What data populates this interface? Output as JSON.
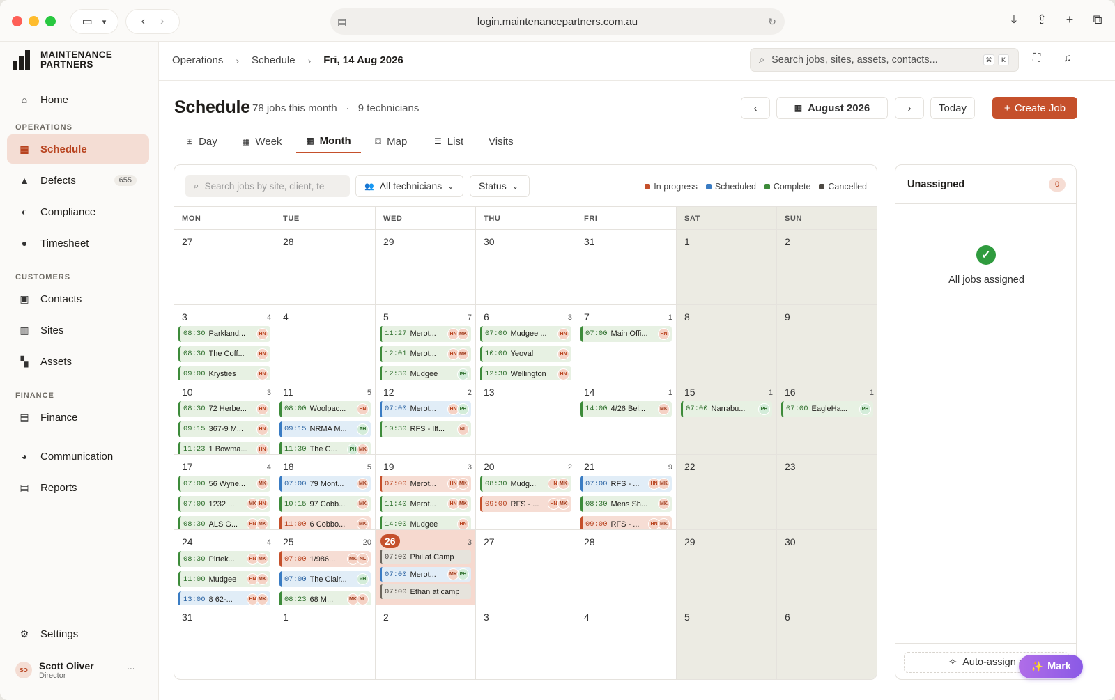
{
  "browser": {
    "url": "login.maintenancepartners.com.au"
  },
  "brand": {
    "line1": "MAINTENANCE",
    "line2": "PARTNERS"
  },
  "sidebar": {
    "home": "Home",
    "sec_operations": "OPERATIONS",
    "schedule": "Schedule",
    "defects": "Defects",
    "defects_count": "655",
    "compliance": "Compliance",
    "timesheet": "Timesheet",
    "sec_customers": "CUSTOMERS",
    "contacts": "Contacts",
    "sites": "Sites",
    "assets": "Assets",
    "sec_finance": "FINANCE",
    "finance": "Finance",
    "communication": "Communication",
    "reports": "Reports",
    "settings": "Settings",
    "user": {
      "initials": "SO",
      "name": "Scott Oliver",
      "role": "Director",
      "more": "..."
    }
  },
  "breadcrumb": {
    "b1": "Operations",
    "b2": "Schedule",
    "b3": "Fri, 14 Aug 2026"
  },
  "global_search": {
    "placeholder": "Search jobs, sites, assets, contacts...",
    "k1": "⌘",
    "k2": "K"
  },
  "page": {
    "title": "Schedule",
    "jobs_meta": "78 jobs this month",
    "dot": "·",
    "tech_meta": "9 technicians",
    "month": "August 2026",
    "today": "Today",
    "create": "Create Job"
  },
  "tabs": {
    "day": "Day",
    "week": "Week",
    "month": "Month",
    "map": "Map",
    "list": "List",
    "visits": "Visits"
  },
  "filters": {
    "search_placeholder": "Search jobs by site, client, te",
    "technicians": "All technicians",
    "status": "Status"
  },
  "legend": [
    {
      "label": "In progress",
      "color": "#c5502b"
    },
    {
      "label": "Scheduled",
      "color": "#3a7cc3"
    },
    {
      "label": "Complete",
      "color": "#3d8b3a"
    },
    {
      "label": "Cancelled",
      "color": "#4d4943"
    }
  ],
  "weekdays": [
    "MON",
    "TUE",
    "WED",
    "THU",
    "FRI",
    "SAT",
    "SUN"
  ],
  "weeks": [
    [
      {
        "d": "27"
      },
      {
        "d": "28"
      },
      {
        "d": "29"
      },
      {
        "d": "30"
      },
      {
        "d": "31"
      },
      {
        "d": "1",
        "we": true
      },
      {
        "d": "2",
        "we": true
      }
    ],
    [
      {
        "d": "3",
        "n": "4",
        "ev": [
          {
            "t": "08:30",
            "name": "Parkland...",
            "s": "c",
            "av": [
              "HN"
            ]
          },
          {
            "t": "08:30",
            "name": "The Coff...",
            "s": "c",
            "av": [
              "HN"
            ]
          },
          {
            "t": "09:00",
            "name": "Krysties",
            "s": "c",
            "av": [
              "HN"
            ]
          }
        ]
      },
      {
        "d": "4"
      },
      {
        "d": "5",
        "n": "7",
        "ev": [
          {
            "t": "11:27",
            "name": "Merot...",
            "s": "c",
            "av": [
              "HN",
              "MK"
            ]
          },
          {
            "t": "12:01",
            "name": "Merot...",
            "s": "c",
            "av": [
              "HN",
              "MK"
            ]
          },
          {
            "t": "12:30",
            "name": "Mudgee",
            "s": "c",
            "av": [
              "PH"
            ]
          }
        ]
      },
      {
        "d": "6",
        "n": "3",
        "ev": [
          {
            "t": "07:00",
            "name": "Mudgee ...",
            "s": "c",
            "av": [
              "HN"
            ]
          },
          {
            "t": "10:00",
            "name": "Yeoval",
            "s": "c",
            "av": [
              "HN"
            ]
          },
          {
            "t": "12:30",
            "name": "Wellington",
            "s": "c",
            "av": [
              "HN"
            ]
          }
        ]
      },
      {
        "d": "7",
        "n": "1",
        "ev": [
          {
            "t": "07:00",
            "name": "Main Offi...",
            "s": "c",
            "av": [
              "HN"
            ]
          }
        ]
      },
      {
        "d": "8",
        "we": true
      },
      {
        "d": "9",
        "we": true
      }
    ],
    [
      {
        "d": "10",
        "n": "3",
        "ev": [
          {
            "t": "08:30",
            "name": "72 Herbe...",
            "s": "c",
            "av": [
              "HN"
            ]
          },
          {
            "t": "09:15",
            "name": "367-9 M...",
            "s": "c",
            "av": [
              "HN"
            ]
          },
          {
            "t": "11:23",
            "name": "1 Bowma...",
            "s": "c",
            "av": [
              "HN"
            ]
          }
        ]
      },
      {
        "d": "11",
        "n": "5",
        "ev": [
          {
            "t": "08:00",
            "name": "Woolpac...",
            "s": "c",
            "av": [
              "HN"
            ]
          },
          {
            "t": "09:15",
            "name": "NRMA M...",
            "s": "s",
            "av": [
              "PH"
            ]
          },
          {
            "t": "11:30",
            "name": "The C...",
            "s": "c",
            "av": [
              "PH",
              "MK"
            ]
          }
        ]
      },
      {
        "d": "12",
        "n": "2",
        "ev": [
          {
            "t": "07:00",
            "name": "Merot...",
            "s": "s",
            "av": [
              "HN",
              "PH"
            ]
          },
          {
            "t": "10:30",
            "name": "RFS - Ilf...",
            "s": "c",
            "av": [
              "NL"
            ]
          }
        ]
      },
      {
        "d": "13"
      },
      {
        "d": "14",
        "n": "1",
        "ev": [
          {
            "t": "14:00",
            "name": "4/26 Bel...",
            "s": "c",
            "av": [
              "MK"
            ]
          }
        ]
      },
      {
        "d": "15",
        "n": "1",
        "we": true,
        "ev": [
          {
            "t": "07:00",
            "name": "Narrabu...",
            "s": "c",
            "av": [
              "PH"
            ]
          }
        ]
      },
      {
        "d": "16",
        "n": "1",
        "we": true,
        "ev": [
          {
            "t": "07:00",
            "name": "EagleHa...",
            "s": "c",
            "av": [
              "PH"
            ]
          }
        ]
      }
    ],
    [
      {
        "d": "17",
        "n": "4",
        "ev": [
          {
            "t": "07:00",
            "name": "56 Wyne...",
            "s": "c",
            "av": [
              "MK"
            ]
          },
          {
            "t": "07:00",
            "name": "1232 ...",
            "s": "c",
            "av": [
              "MK",
              "HN"
            ]
          },
          {
            "t": "08:30",
            "name": "ALS G...",
            "s": "c",
            "av": [
              "HN",
              "MK"
            ]
          }
        ]
      },
      {
        "d": "18",
        "n": "5",
        "ev": [
          {
            "t": "07:00",
            "name": "79 Mont...",
            "s": "s",
            "av": [
              "MK"
            ]
          },
          {
            "t": "10:15",
            "name": "97 Cobb...",
            "s": "c",
            "av": [
              "MK"
            ]
          },
          {
            "t": "11:00",
            "name": "6 Cobbo...",
            "s": "p",
            "av": [
              "MK"
            ]
          }
        ]
      },
      {
        "d": "19",
        "n": "3",
        "ev": [
          {
            "t": "07:00",
            "name": "Merot...",
            "s": "p",
            "av": [
              "HN",
              "MK"
            ]
          },
          {
            "t": "11:40",
            "name": "Merot...",
            "s": "c",
            "av": [
              "HN",
              "MK"
            ]
          },
          {
            "t": "14:00",
            "name": "Mudgee",
            "s": "c",
            "av": [
              "HN"
            ]
          }
        ]
      },
      {
        "d": "20",
        "n": "2",
        "ev": [
          {
            "t": "08:30",
            "name": "Mudg...",
            "s": "c",
            "av": [
              "HN",
              "MK"
            ]
          },
          {
            "t": "09:00",
            "name": "RFS - ...",
            "s": "p",
            "av": [
              "HN",
              "MK"
            ]
          }
        ]
      },
      {
        "d": "21",
        "n": "9",
        "ev": [
          {
            "t": "07:00",
            "name": "RFS - ...",
            "s": "s",
            "av": [
              "HN",
              "MK"
            ]
          },
          {
            "t": "08:30",
            "name": "Mens Sh...",
            "s": "c",
            "av": [
              "MK"
            ]
          },
          {
            "t": "09:00",
            "name": "RFS - ...",
            "s": "p",
            "av": [
              "HN",
              "MK"
            ]
          }
        ]
      },
      {
        "d": "22",
        "we": true
      },
      {
        "d": "23",
        "we": true
      }
    ],
    [
      {
        "d": "24",
        "n": "4",
        "ev": [
          {
            "t": "08:30",
            "name": "Pirtek...",
            "s": "c",
            "av": [
              "HN",
              "MK"
            ]
          },
          {
            "t": "11:00",
            "name": "Mudgee",
            "s": "c",
            "av": [
              "HN",
              "MK"
            ]
          },
          {
            "t": "13:00",
            "name": "8 62-...",
            "s": "s",
            "av": [
              "HN",
              "MK"
            ]
          }
        ]
      },
      {
        "d": "25",
        "n": "20",
        "ev": [
          {
            "t": "07:00",
            "name": "1/986...",
            "s": "p",
            "av": [
              "MK",
              "NL"
            ]
          },
          {
            "t": "07:00",
            "name": "The Clair...",
            "s": "s",
            "av": [
              "PH"
            ]
          },
          {
            "t": "08:23",
            "name": "68 M...",
            "s": "c",
            "av": [
              "MK",
              "NL"
            ]
          }
        ]
      },
      {
        "d": "26",
        "n": "3",
        "today": true,
        "ev": [
          {
            "t": "07:00",
            "name": "Phil at Camp",
            "s": "x",
            "av": []
          },
          {
            "t": "07:00",
            "name": "Merot...",
            "s": "s",
            "av": [
              "MK",
              "PH"
            ]
          },
          {
            "t": "07:00",
            "name": "Ethan at camp",
            "s": "x",
            "av": []
          }
        ]
      },
      {
        "d": "27"
      },
      {
        "d": "28"
      },
      {
        "d": "29",
        "we": true
      },
      {
        "d": "30",
        "we": true
      }
    ],
    [
      {
        "d": "31"
      },
      {
        "d": "1"
      },
      {
        "d": "2"
      },
      {
        "d": "3"
      },
      {
        "d": "4"
      },
      {
        "d": "5",
        "we": true
      },
      {
        "d": "6",
        "we": true
      }
    ]
  ],
  "unassigned": {
    "title": "Unassigned",
    "count": "0",
    "empty": "All jobs assigned",
    "auto": "Auto-assign a"
  },
  "mark": {
    "label": "Mark"
  }
}
